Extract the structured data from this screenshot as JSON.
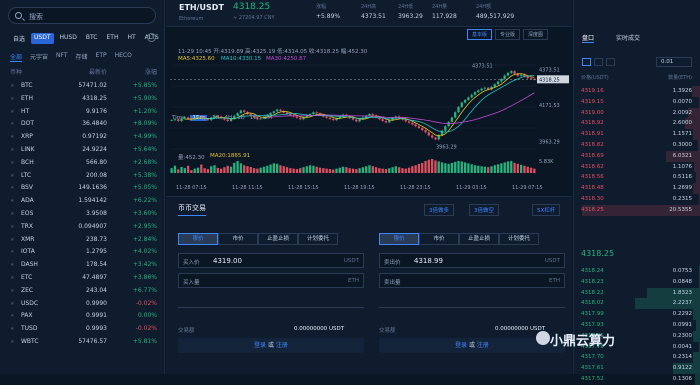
{
  "search": {
    "placeholder": "搜索"
  },
  "quote_tabs": [
    "自选",
    "USDT",
    "HUSD",
    "BTC",
    "ETH",
    "HT",
    "ALTS"
  ],
  "quote_tab_active": 1,
  "category_tabs": [
    "全部",
    "元宇宙",
    "NFT",
    "存储",
    "ETP",
    "HECO"
  ],
  "list_header": {
    "coin": "币种",
    "price": "最新价",
    "change": "涨幅"
  },
  "coins": [
    {
      "sym": "BTC",
      "price": "57471.02",
      "chg": "+5.85%",
      "up": true
    },
    {
      "sym": "ETH",
      "price": "4318.25",
      "chg": "+5.90%",
      "up": true
    },
    {
      "sym": "HT",
      "price": "9.9176",
      "chg": "+1.20%",
      "up": true
    },
    {
      "sym": "DOT",
      "price": "36.4840",
      "chg": "+8.09%",
      "up": true
    },
    {
      "sym": "XRP",
      "price": "0.97192",
      "chg": "+4.99%",
      "up": true
    },
    {
      "sym": "LINK",
      "price": "24.9224",
      "chg": "+5.64%",
      "up": true
    },
    {
      "sym": "BCH",
      "price": "566.80",
      "chg": "+2.68%",
      "up": true
    },
    {
      "sym": "LTC",
      "price": "200.08",
      "chg": "+5.38%",
      "up": true
    },
    {
      "sym": "BSV",
      "price": "149.1636",
      "chg": "+5.05%",
      "up": true
    },
    {
      "sym": "ADA",
      "price": "1.594142",
      "chg": "+6.22%",
      "up": true
    },
    {
      "sym": "EOS",
      "price": "3.9508",
      "chg": "+3.60%",
      "up": true
    },
    {
      "sym": "TRX",
      "price": "0.094907",
      "chg": "+2.95%",
      "up": true
    },
    {
      "sym": "XMR",
      "price": "238.73",
      "chg": "+2.84%",
      "up": true
    },
    {
      "sym": "IOTA",
      "price": "1.2795",
      "chg": "+4.02%",
      "up": true
    },
    {
      "sym": "DASH",
      "price": "178.54",
      "chg": "+3.42%",
      "up": true
    },
    {
      "sym": "ETC",
      "price": "47.4897",
      "chg": "+3.86%",
      "up": true
    },
    {
      "sym": "ZEC",
      "price": "243.04",
      "chg": "+6.77%",
      "up": true
    },
    {
      "sym": "USDC",
      "price": "0.9990",
      "chg": "-0.02%",
      "up": false
    },
    {
      "sym": "PAX",
      "price": "0.9991",
      "chg": "0.00%",
      "up": true
    },
    {
      "sym": "TUSD",
      "price": "0.9993",
      "chg": "-0.02%",
      "up": false
    },
    {
      "sym": "WBTC",
      "price": "57476.57",
      "chg": "+5.81%",
      "up": true
    }
  ],
  "ticker": {
    "pair": "ETH/USDT",
    "name": "Ethereum",
    "last": "4318.25",
    "cny": "≈ 27204.97 CNY",
    "stats": [
      {
        "label": "涨幅",
        "value": "+5.89%",
        "up": true
      },
      {
        "label": "24H高",
        "value": "4373.51",
        "up": null
      },
      {
        "label": "24H低",
        "value": "3963.29",
        "up": null
      },
      {
        "label": "24H量",
        "value": "117,928",
        "up": null
      },
      {
        "label": "24H额",
        "value": "489,517,929",
        "up": null
      }
    ]
  },
  "chart_controls": {
    "modes": [
      "基本版",
      "专业版",
      "深度图"
    ],
    "timeframes": [
      "Time",
      "15m",
      "1H",
      "4H",
      "1D",
      "1W",
      "1M"
    ],
    "tf_active": 1,
    "ohlc": "11-29 10:45  开:4319.89  高:4325.19  低:4314.05  收:4318.25  幅:452.30",
    "ma": {
      "ma5": "MA5:4325.60",
      "ma10": "MA10:4330.15",
      "ma30": "MA30:4250.87"
    },
    "vol": {
      "vol": "量:452.30",
      "ma20": "MA20:1865.91"
    },
    "annot_high": "4373.51",
    "annot_low": "3963.29",
    "vol_tick": "5.83K"
  },
  "chart_data": {
    "type": "candlestick",
    "x_ticks": [
      "11-28 07:15",
      "11-28 11:15",
      "11-28 15:15",
      "11-28 19:15",
      "11-28 23:15",
      "11-29 03:15",
      "11-29 07:15"
    ],
    "y_ticks": [
      "4373.51",
      "4318.25",
      "4171.53",
      "3963.29"
    ],
    "ylim": [
      3920,
      4400
    ],
    "high": 4373.51,
    "low": 3963.29,
    "last": 4318.25,
    "closes": [
      4085,
      4090,
      4080,
      4095,
      4100,
      4092,
      4088,
      4096,
      4105,
      4098,
      4090,
      4085,
      4100,
      4110,
      4106,
      4095,
      4088,
      4080,
      4092,
      4110,
      4125,
      4140,
      4132,
      4120,
      4110,
      4100,
      4090,
      4095,
      4105,
      4115,
      4126,
      4135,
      4145,
      4138,
      4128,
      4120,
      4112,
      4105,
      4098,
      4090,
      4100,
      4112,
      4120,
      4130,
      4124,
      4115,
      4105,
      4098,
      4092,
      4085,
      4095,
      4105,
      4116,
      4108,
      4096,
      4088,
      4078,
      4090,
      4100,
      4110,
      4120,
      4112,
      4100,
      4090,
      4080,
      4072,
      4085,
      4096,
      4106,
      4098,
      4088,
      4078,
      4070,
      4060,
      4050,
      4040,
      4028,
      4015,
      3998,
      3985,
      3975,
      4000,
      4025,
      4050,
      4075,
      4100,
      4130,
      4160,
      4185,
      4200,
      4215,
      4230,
      4245,
      4255,
      4265,
      4270,
      4260,
      4275,
      4290,
      4305,
      4320,
      4340,
      4355,
      4365,
      4350,
      4338,
      4345,
      4335,
      4325,
      4320,
      4318
    ],
    "volumes": [
      2,
      3,
      1.5,
      2.5,
      2,
      3,
      1.2,
      1.8,
      2.2,
      3.5,
      2,
      1.6,
      2.8,
      3.2,
      2.1,
      1.8,
      2.4,
      3,
      2.6,
      4.2,
      5,
      4,
      3.2,
      2.8,
      2.5,
      2,
      1.8,
      2.2,
      2.6,
      3,
      3.5,
      4,
      3.8,
      3.2,
      2.8,
      2.4,
      2,
      1.8,
      1.6,
      2,
      2.4,
      2.8,
      3.2,
      3,
      2.6,
      2.2,
      2,
      1.8,
      1.6,
      1.4,
      1.8,
      2.2,
      2.6,
      2.4,
      2,
      1.8,
      1.6,
      2,
      2.4,
      2.8,
      3.2,
      2.8,
      2.4,
      2,
      1.8,
      1.6,
      2,
      2.4,
      2.8,
      2.4,
      2,
      1.8,
      2.2,
      2.8,
      3.2,
      3.8,
      4.2,
      5,
      5.5,
      5.8,
      5.2,
      4.8,
      4.4,
      4,
      3.8,
      4.2,
      4.6,
      5,
      4.8,
      4.4,
      4,
      3.6,
      3.2,
      3,
      2.8,
      2.6,
      2.4,
      2.8,
      3.2,
      3.6,
      4,
      4.4,
      4.8,
      5,
      4.2,
      3.8,
      3.4,
      3,
      2.6,
      2.2,
      1.8
    ]
  },
  "trade": {
    "title": "币币交易",
    "buttons": [
      "3倍做多",
      "3倍做空",
      "5X杠杆"
    ],
    "order_tabs": [
      "限价",
      "市价",
      "止盈止损",
      "计划委托"
    ],
    "buy": {
      "price_label": "买入价",
      "price": "4319.00",
      "unit": "USDT",
      "amt_label": "买入量",
      "amt_unit": "ETH",
      "total_label": "交易额",
      "total": "0.00000000 USDT"
    },
    "sell": {
      "price_label": "卖出价",
      "price": "4318.99",
      "unit": "USDT",
      "amt_label": "卖出量",
      "amt_unit": "ETH",
      "total_label": "交易额",
      "total": "0.00000000 USDT"
    },
    "login": "登录",
    "or": "或",
    "register": "注册"
  },
  "orderbook": {
    "tabs": [
      "盘口",
      "实时成交"
    ],
    "depth": "0.01",
    "header": {
      "price": "价格(USDT)",
      "qty": "数量(ETH)"
    },
    "asks": [
      {
        "p": "4319.16",
        "q": "1.3926",
        "w": 0.07
      },
      {
        "p": "4319.15",
        "q": "0.0070",
        "w": 0.01
      },
      {
        "p": "4319.00",
        "q": "2.0092",
        "w": 0.1
      },
      {
        "p": "4318.92",
        "q": "2.6000",
        "w": 0.13
      },
      {
        "p": "4318.91",
        "q": "1.1571",
        "w": 0.06
      },
      {
        "p": "4318.82",
        "q": "0.3000",
        "w": 0.02
      },
      {
        "p": "4318.69",
        "q": "6.0321",
        "w": 0.29
      },
      {
        "p": "4318.62",
        "q": "1.1076",
        "w": 0.05
      },
      {
        "p": "4318.56",
        "q": "0.5116",
        "w": 0.03
      },
      {
        "p": "4318.48",
        "q": "1.2699",
        "q2": "",
        "w": 0.06
      },
      {
        "p": "4318.30",
        "q": "0.2315",
        "w": 0.01
      },
      {
        "p": "4318.25",
        "q": "20.5355",
        "w": 1.0
      }
    ],
    "mid": "4318.25",
    "bids": [
      {
        "p": "4318.24",
        "q": "0.0753",
        "w": 0.01
      },
      {
        "p": "4318.23",
        "q": "0.0848",
        "w": 0.01
      },
      {
        "p": "4318.22",
        "q": "1.8323",
        "w": 0.45
      },
      {
        "p": "4318.02",
        "q": "2.2237",
        "w": 0.55
      },
      {
        "p": "4317.99",
        "q": "0.2292",
        "w": 0.06
      },
      {
        "p": "4317.93",
        "q": "0.0991",
        "w": 0.03
      },
      {
        "p": "4317.85",
        "q": "0.2300",
        "w": 0.06
      },
      {
        "p": "4317.79",
        "q": "0.0041",
        "w": 0.01
      },
      {
        "p": "4317.70",
        "q": "0.2314",
        "w": 0.06
      },
      {
        "p": "4317.61",
        "q": "0.9122",
        "w": 0.23
      },
      {
        "p": "4317.52",
        "q": "0.1306",
        "w": 0.04
      }
    ]
  },
  "watermark": "小鼎云算力"
}
